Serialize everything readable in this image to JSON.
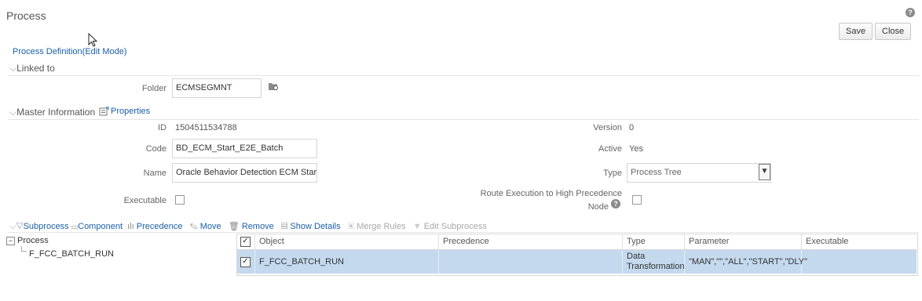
{
  "header": {
    "title": "Process",
    "help_glyph": "?",
    "save_label": "Save",
    "close_label": "Close"
  },
  "breadcrumb": "Process Definition(Edit Mode)",
  "linked_to": {
    "section_label": "Linked to",
    "folder_label": "Folder",
    "folder_value": "ECMSEGMNT"
  },
  "master": {
    "section_label": "Master Information",
    "properties_label": "Properties",
    "id_label": "ID",
    "id_value": "1504511534788",
    "code_label": "Code",
    "code_value": "BD_ECM_Start_E2E_Batch",
    "name_label": "Name",
    "name_value": "Oracle Behavior Detection ECM Start E",
    "executable_label": "Executable",
    "version_label": "Version",
    "version_value": "0",
    "active_label": "Active",
    "active_value": "Yes",
    "type_label": "Type",
    "type_value": "Process Tree",
    "route_label_1": "Route Execution to High Precedence",
    "route_label_2": "Node"
  },
  "toolbar": {
    "subprocess": "Subprocess",
    "component": "Component",
    "precedence": "Precedence",
    "move": "Move",
    "remove": "Remove",
    "show_details": "Show Details",
    "merge_rules": "Merge Rules",
    "edit_subprocess": "Edit Subprocess"
  },
  "tree": {
    "root": "Process",
    "child": "F_FCC_BATCH_RUN"
  },
  "table": {
    "headers": [
      "Object",
      "Precedence",
      "Type",
      "Parameter",
      "Executable"
    ],
    "rows": [
      {
        "object": "F_FCC_BATCH_RUN",
        "precedence": "",
        "type_1": "Data",
        "type_2": "Transformation",
        "parameter": "\"MAN\",\"\",\"ALL\",\"START\",\"DLY\"",
        "executable": ""
      }
    ]
  },
  "icons": [
    "cursor-arrow-icon",
    "folder-browse-icon",
    "properties-icon",
    "filter-icon",
    "component-icon",
    "precedence-icon",
    "move-icon",
    "remove-icon",
    "show-details-icon",
    "merge-rules-icon",
    "edit-subprocess-icon",
    "help-icon",
    "tree-collapse-icon",
    "dropdown-arrow-icon"
  ]
}
